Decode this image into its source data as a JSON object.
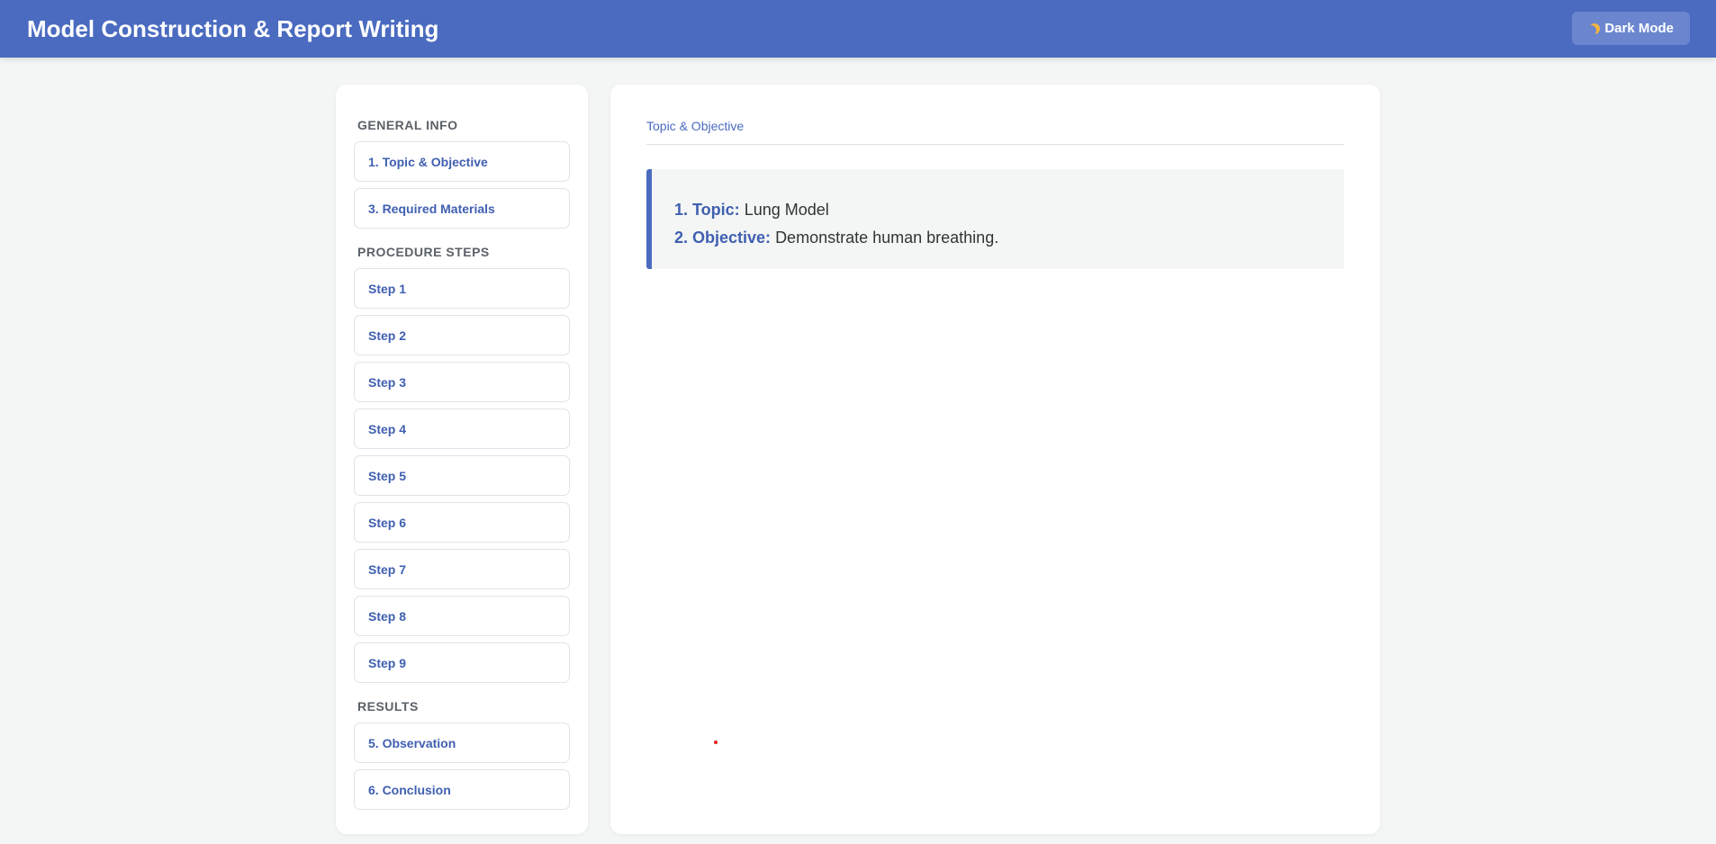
{
  "header": {
    "title": "Model Construction & Report Writing",
    "dark_mode_label": "Dark Mode",
    "dark_mode_icon": "moon-icon",
    "bg_color": "#4a6bc0"
  },
  "sidebar": {
    "sections": [
      {
        "title": "GENERAL INFO",
        "items": [
          "1. Topic & Objective",
          "3. Required Materials"
        ]
      },
      {
        "title": "PROCEDURE STEPS",
        "items": [
          "Step 1",
          "Step 2",
          "Step 3",
          "Step 4",
          "Step 5",
          "Step 6",
          "Step 7",
          "Step 8",
          "Step 9"
        ]
      },
      {
        "title": "RESULTS",
        "items": [
          "5. Observation",
          "6. Conclusion"
        ]
      }
    ]
  },
  "main": {
    "breadcrumb": "Topic & Objective",
    "topic_label": "1. Topic:",
    "topic_value": "Lung Model",
    "objective_label": "2. Objective:",
    "objective_value": "Demonstrate human breathing."
  },
  "colors": {
    "accent": "#4a6bc0",
    "page_bg": "#f4f6f6"
  }
}
